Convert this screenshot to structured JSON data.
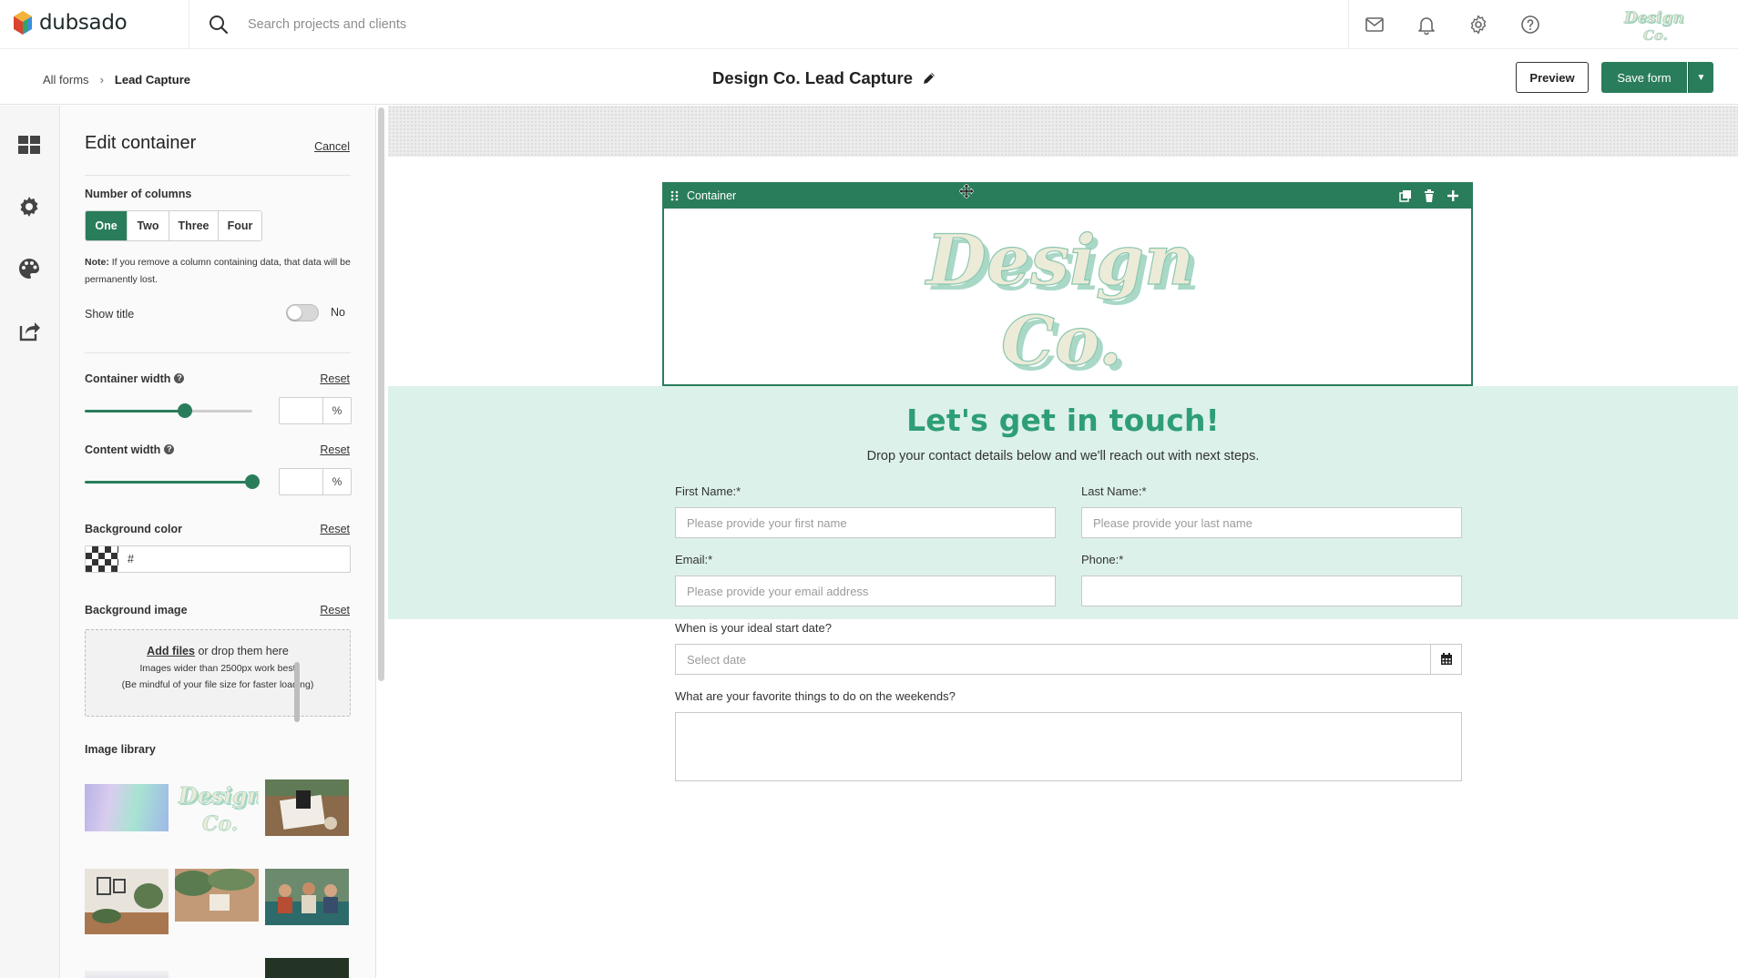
{
  "app": {
    "name": "dubsado"
  },
  "topbar": {
    "search_placeholder": "Search projects and clients",
    "icons": [
      "mail-icon",
      "bell-icon",
      "gear-icon",
      "help-icon"
    ]
  },
  "subheader": {
    "breadcrumb": {
      "root": "All forms",
      "current": "Lead Capture"
    },
    "form_title": "Design Co. Lead Capture",
    "preview_label": "Preview",
    "save_label": "Save form"
  },
  "rail": {
    "icons": [
      "layout-grid-icon",
      "settings-gear-icon",
      "palette-icon",
      "share-icon"
    ]
  },
  "panel": {
    "title": "Edit container",
    "cancel_label": "Cancel",
    "columns_label": "Number of columns",
    "columns": [
      "One",
      "Two",
      "Three",
      "Four"
    ],
    "columns_selected": "One",
    "note_bold": "Note:",
    "note_text": "If you remove a column containing data, that data will be permanently lost.",
    "show_title_label": "Show title",
    "show_title_value": "No",
    "container_width_label": "Container width",
    "container_width_reset": "Reset",
    "container_width_value": 0.6,
    "content_width_label": "Content width",
    "content_width_reset": "Reset",
    "content_width_value": 1.0,
    "percent_symbol": "%",
    "help_glyph": "?",
    "bg_color_label": "Background color",
    "bg_color_reset": "Reset",
    "bg_color_value": "#",
    "bg_image_label": "Background image",
    "bg_image_reset": "Reset",
    "dropzone_link": "Add files",
    "dropzone_text": " or drop them here",
    "dropzone_hint1": "Images wider than 2500px work best",
    "dropzone_hint2": "(Be mindful of your file size for faster loading)",
    "image_library_label": "Image library"
  },
  "canvas": {
    "container_label": "Container",
    "logo_line1": "Design",
    "logo_line2": "Co.",
    "headline": "Let's get in touch!",
    "subline": "Drop your contact details below and we'll reach out with next steps.",
    "fields": {
      "first_name_label": "First Name:*",
      "first_name_placeholder": "Please provide your first name",
      "last_name_label": "Last Name:*",
      "last_name_placeholder": "Please provide your last name",
      "email_label": "Email:*",
      "email_placeholder": "Please provide your email address",
      "phone_label": "Phone:*",
      "phone_placeholder": "",
      "start_date_label": "When is your ideal start date?",
      "start_date_placeholder": "Select date",
      "weekends_label": "What are your favorite things to do on the weekends?"
    }
  },
  "colors": {
    "brand_green": "#2a7d5b",
    "headline_green": "#2e9e76",
    "mint_band": "#dcf1ea",
    "logo_cream": "#ecebd8",
    "logo_shadow": "#9fd3bf"
  }
}
